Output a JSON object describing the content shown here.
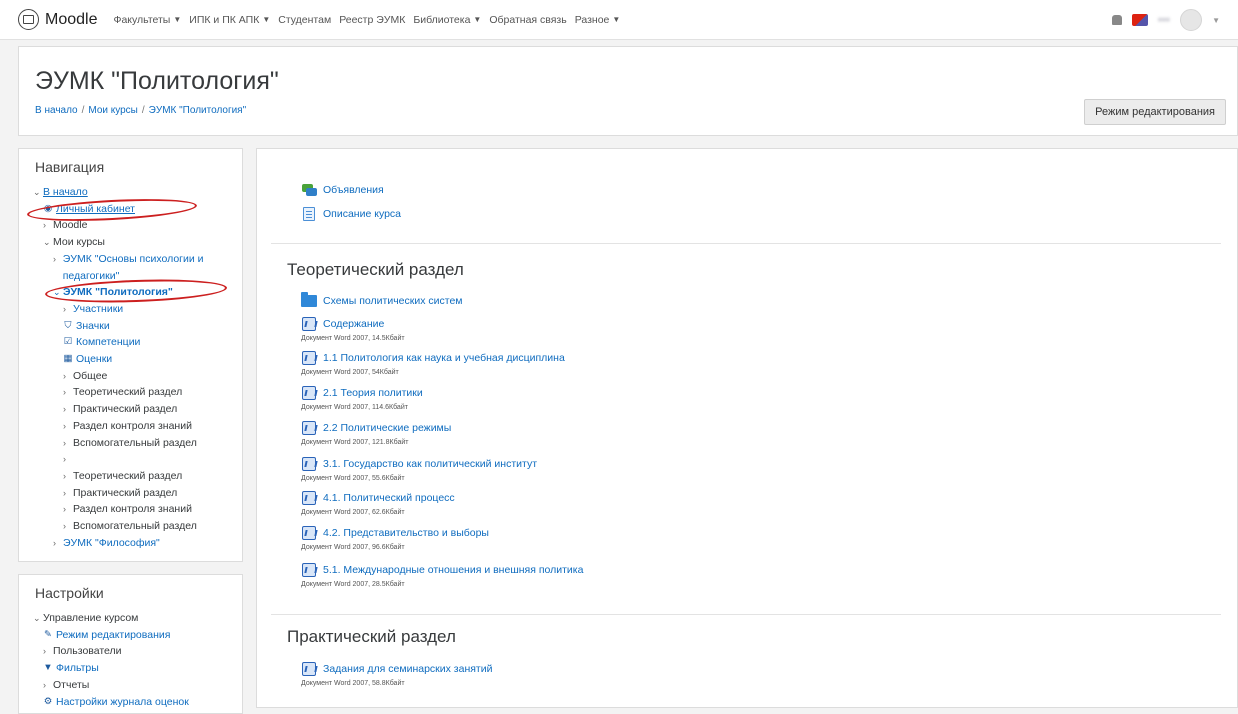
{
  "navbar": {
    "brand": "Moodle",
    "menu": [
      {
        "label": "Факультеты",
        "caret": true
      },
      {
        "label": "ИПК и ПК АПК",
        "caret": true
      },
      {
        "label": "Студентам",
        "caret": false
      },
      {
        "label": "Реестр ЭУМК",
        "caret": false
      },
      {
        "label": "Библиотека",
        "caret": true
      },
      {
        "label": "Обратная связь",
        "caret": false
      },
      {
        "label": "Разное",
        "caret": true
      }
    ],
    "user_name": "•••"
  },
  "header": {
    "title": "ЭУМК \"Политология\"",
    "breadcrumb": [
      "В начало",
      "Мои курсы",
      "ЭУМК \"Политология\""
    ],
    "edit_button": "Режим редактирования"
  },
  "navigation": {
    "title": "Навигация",
    "home": "В начало",
    "dashboard": "Личный кабинет",
    "site": "Moodle",
    "my_courses": "Мои курсы",
    "course_psych": "ЭУМК \"Основы психологии и педагогики\"",
    "current_course": "ЭУМК \"Политология\"",
    "participants": "Участники",
    "badges": "Значки",
    "competencies": "Компетенции",
    "grades": "Оценки",
    "sections": [
      "Общее",
      "Теоретический раздел",
      "Практический раздел",
      "Раздел контроля знаний",
      "Вспомогательный раздел",
      "",
      "Теоретический раздел",
      "Практический раздел",
      "Раздел контроля знаний",
      "Вспомогательный раздел"
    ],
    "course_philosophy": "ЭУМК \"Философия\""
  },
  "settings": {
    "title": "Настройки",
    "course_admin": "Управление курсом",
    "edit_mode": "Режим редактирования",
    "users": "Пользователи",
    "filters": "Фильтры",
    "reports": "Отчеты",
    "gradebook": "Настройки журнала оценок"
  },
  "main": {
    "top_activities": [
      {
        "icon": "forum",
        "label": "Объявления"
      },
      {
        "icon": "page",
        "label": "Описание курса"
      }
    ],
    "sections": [
      {
        "title": "Теоретический раздел",
        "folder": "Схемы политических систем",
        "files": [
          {
            "label": "Содержание",
            "meta": "Документ Word 2007, 14.5Кбайт"
          },
          {
            "label": "1.1 Политология как наука и учебная дисциплина",
            "meta": "Документ Word 2007, 54Кбайт"
          },
          {
            "label": "2.1 Теория политики",
            "meta": "Документ Word 2007, 114.6Кбайт"
          },
          {
            "label": "2.2 Политические режимы",
            "meta": "Документ Word 2007, 121.8Кбайт"
          },
          {
            "label": "3.1. Государство как политический институт",
            "meta": "Документ Word 2007, 55.6Кбайт"
          },
          {
            "label": "4.1. Политический процесс",
            "meta": "Документ Word 2007, 62.6Кбайт"
          },
          {
            "label": "4.2. Представительство и выборы",
            "meta": "Документ Word 2007, 96.6Кбайт"
          },
          {
            "label": "5.1. Международные отношения и внешняя политика",
            "meta": "Документ Word 2007, 28.5Кбайт"
          }
        ]
      },
      {
        "title": "Практический раздел",
        "files": [
          {
            "label": "Задания для семинарских занятий",
            "meta": "Документ Word 2007, 58.8Кбайт"
          }
        ]
      }
    ]
  }
}
